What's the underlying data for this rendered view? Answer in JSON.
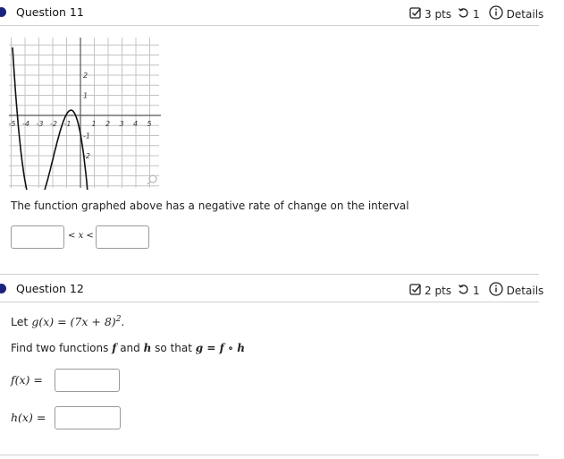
{
  "question11": {
    "title": "Question 11",
    "points": "3 pts",
    "attempts": "1",
    "details": "Details",
    "graph": {
      "x_ticks": [
        "-5",
        "-4",
        "-3",
        "-2",
        "-1",
        "1",
        "2",
        "3",
        "4",
        "5"
      ],
      "y_ticks": [
        "2",
        "1",
        "-1",
        "-2"
      ]
    },
    "prompt": "The function graphed above has a negative rate of change on the interval",
    "inequality_left": "<",
    "inequality_var": "x",
    "inequality_right": "<",
    "answer1_value": "",
    "answer2_value": ""
  },
  "question12": {
    "title": "Question 12",
    "points": "2 pts",
    "attempts": "1",
    "details": "Details",
    "let_text": "Let",
    "g_def": "g(x) = (7x + 8)",
    "g_exp": "2",
    "g_period": ".",
    "instruction_prefix": "Find two functions",
    "f_sym": "f",
    "and_text": "and",
    "h_sym": "h",
    "so_that": "so that",
    "composition": "g = f ∘ h",
    "f_label": "f(x) =",
    "h_label": "h(x) =",
    "f_value": "",
    "h_value": ""
  },
  "colors": {
    "accent": "#1a237e"
  }
}
